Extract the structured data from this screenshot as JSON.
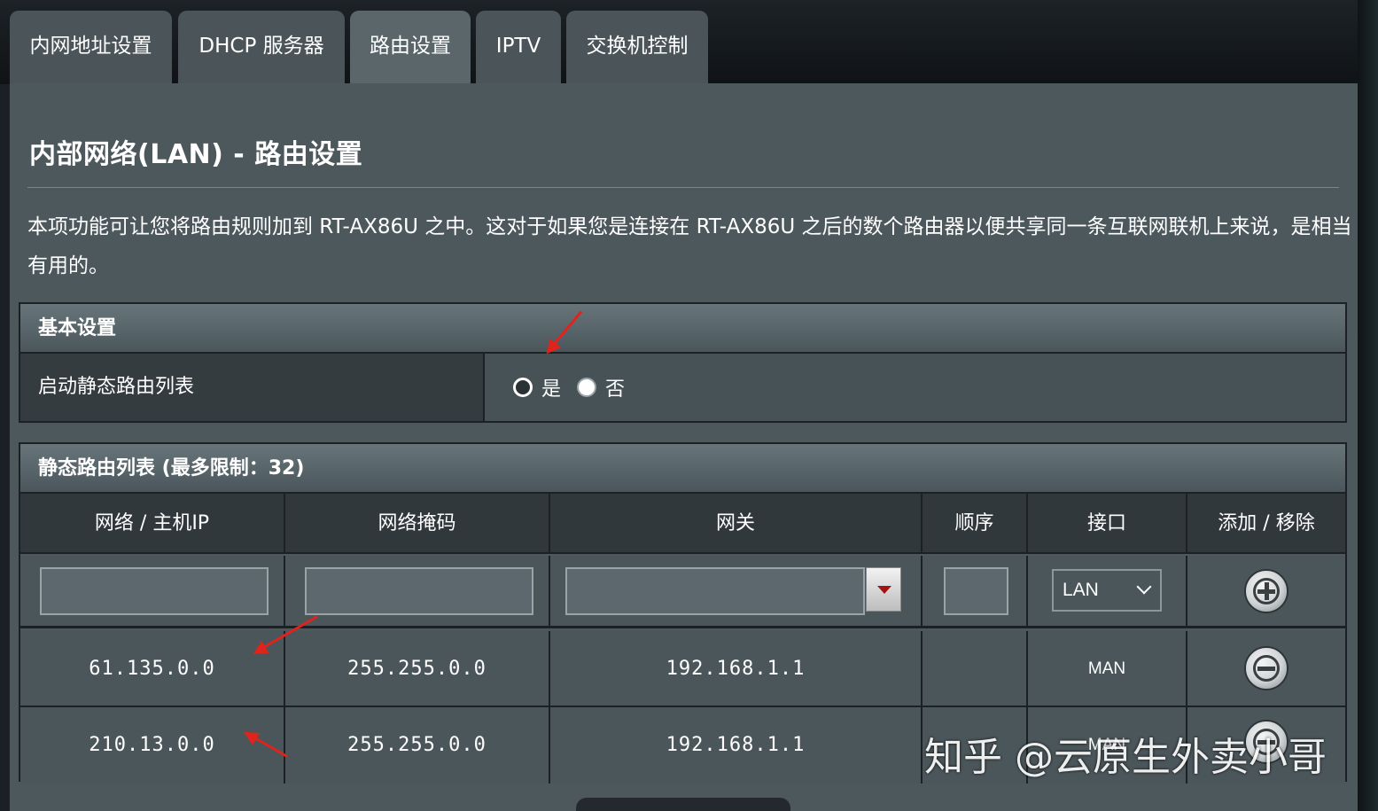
{
  "tabs": [
    {
      "label": "内网地址设置"
    },
    {
      "label": "DHCP 服务器"
    },
    {
      "label": "路由设置"
    },
    {
      "label": "IPTV"
    },
    {
      "label": "交换机控制"
    }
  ],
  "active_tab": "路由设置",
  "page_title": "内部网络(LAN) - 路由设置",
  "description": "本项功能可让您将路由规则加到 RT-AX86U 之中。这对于如果您是连接在 RT-AX86U 之后的数个路由器以便共享同一条互联网联机上来说，是相当有用的。",
  "basic": {
    "header": "基本设置",
    "label": "启动静态路由列表",
    "yes": "是",
    "no": "否"
  },
  "routes": {
    "header": "静态路由列表 (最多限制：32)",
    "columns": [
      "网络 / 主机IP",
      "网络掩码",
      "网关",
      "顺序",
      "接口",
      "添加 / 移除"
    ],
    "interface_select": "LAN",
    "rows": [
      {
        "network": "61.135.0.0",
        "netmask": "255.255.0.0",
        "gateway": "192.168.1.1",
        "metric": "",
        "interface": "MAN"
      },
      {
        "network": "210.13.0.0",
        "netmask": "255.255.0.0",
        "gateway": "192.168.1.1",
        "metric": "",
        "interface": "MAN"
      }
    ]
  },
  "watermark": "知乎 @云原生外卖小哥",
  "colors": {
    "accent_arrow": "#e0231b",
    "panel": "#4d585d"
  },
  "icons": [
    "dropdown-icon",
    "add-icon",
    "remove-icon",
    "chevron-down-icon"
  ]
}
